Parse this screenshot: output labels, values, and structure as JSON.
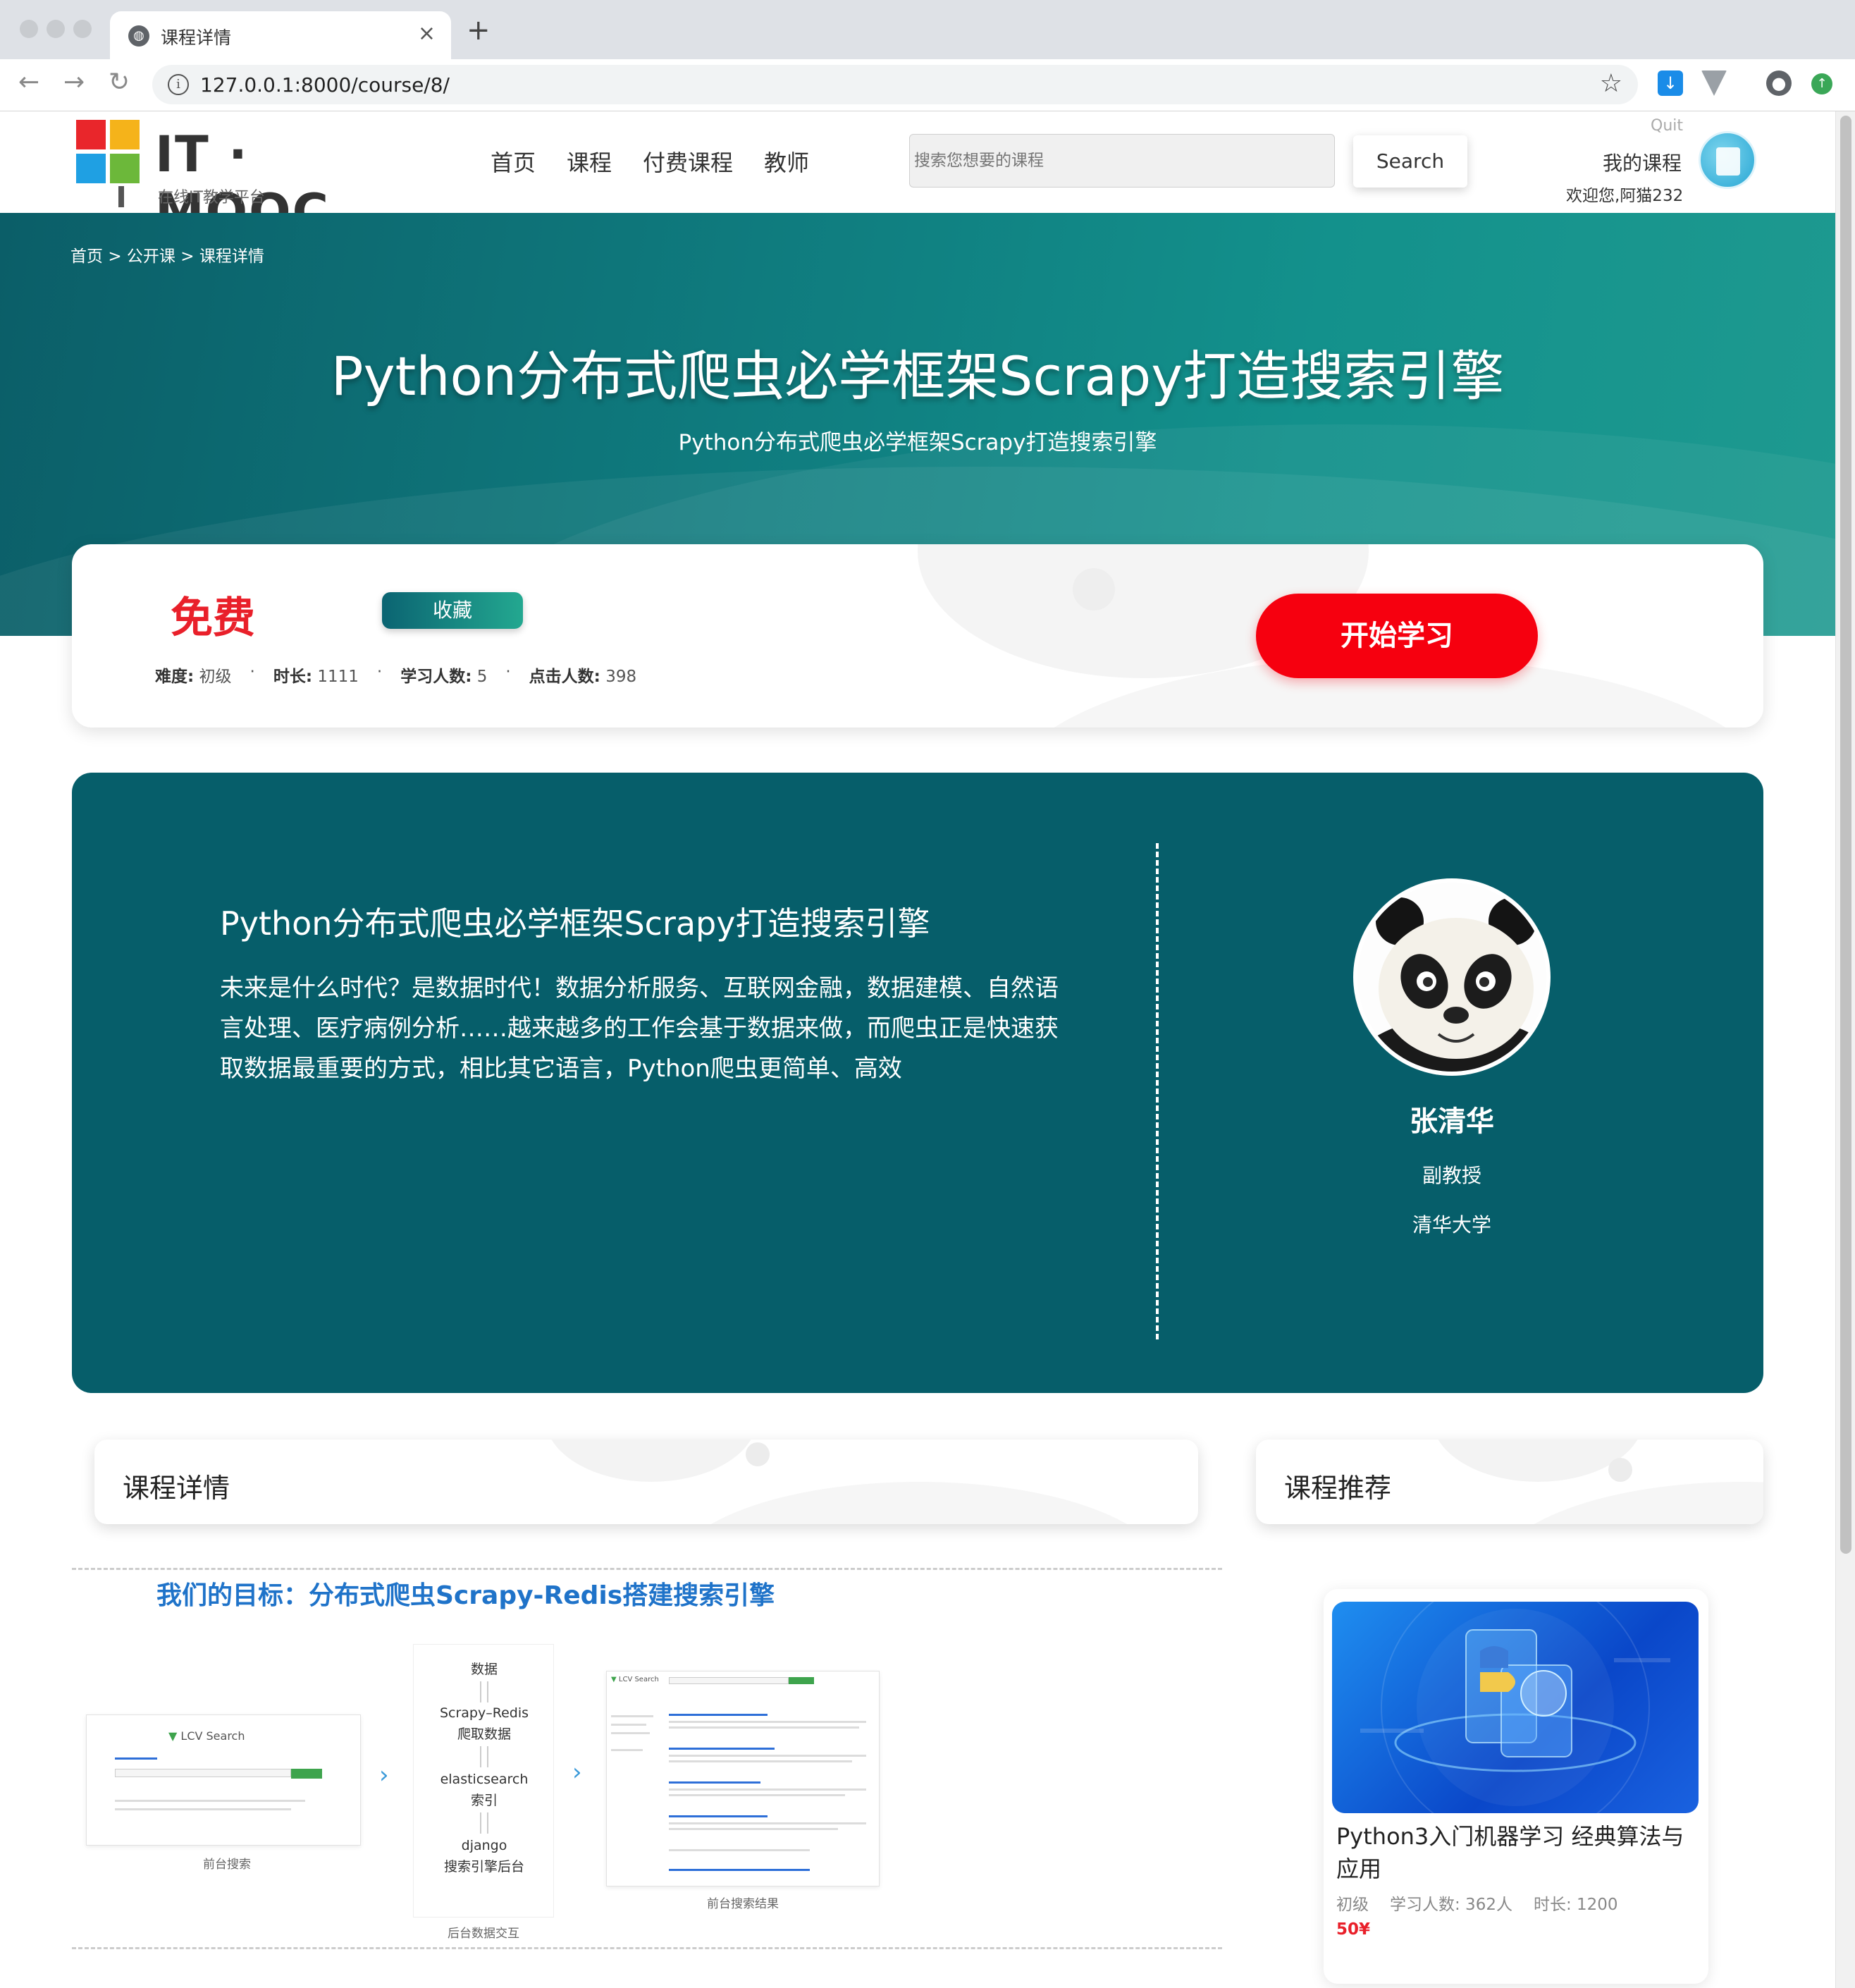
{
  "browser": {
    "tab_title": "课程详情",
    "url": "127.0.0.1:8000/course/8/"
  },
  "header": {
    "logo_text": "IT · MOOC",
    "logo_sub": "在线IT教学平台",
    "nav": [
      "首页",
      "课程",
      "付费课程",
      "教师"
    ],
    "search_placeholder": "搜索您想要的课程",
    "search_button": "Search",
    "quit": "Quit",
    "my_course": "我的课程",
    "welcome": "欢迎您,阿猫232"
  },
  "hero": {
    "breadcrumb": [
      "首页",
      "公开课",
      "课程详情"
    ],
    "breadcrumb_sep": ">",
    "title": "Python分布式爬虫必学框架Scrapy打造搜索引擎",
    "subtitle": "Python分布式爬虫必学框架Scrapy打造搜索引擎"
  },
  "course_info": {
    "price": "免费",
    "favorite": "收藏",
    "start": "开始学习",
    "stats": [
      {
        "label": "难度:",
        "value": "初级"
      },
      {
        "label": "时长:",
        "value": "1111"
      },
      {
        "label": "学习人数:",
        "value": "5"
      },
      {
        "label": "点击人数:",
        "value": "398"
      }
    ]
  },
  "teacher_panel": {
    "course_title": "Python分布式爬虫必学框架Scrapy打造搜索引擎",
    "description": "未来是什么时代？是数据时代！数据分析服务、互联网金融，数据建模、自然语言处理、医疗病例分析……越来越多的工作会基于数据来做，而爬虫正是快速获取数据最重要的方式，相比其它语言，Python爬虫更简单、高效",
    "teacher_name": "张清华",
    "teacher_title": "副教授",
    "teacher_school": "清华大学"
  },
  "sections": {
    "detail": "课程详情",
    "recommend": "课程推荐"
  },
  "detail_content": {
    "goal": "我们的目标：分布式爬虫Scrapy-Redis搭建搜索引擎",
    "front_caption": "前台搜索",
    "flow": {
      "data": "数据",
      "scrapy1": "Scrapy–Redis",
      "scrapy2": "爬取数据",
      "es1": "elasticsearch",
      "es2": "索引",
      "django1": "django",
      "django2": "搜索引擎后台"
    },
    "backend_caption": "后台数据交互",
    "results_caption": "前台搜索结果",
    "lcv_logo": "LCV Search"
  },
  "recommendation": {
    "title": "Python3入门机器学习 经典算法与应用",
    "level": "初级",
    "students": "学习人数: 362人",
    "duration": "时长: 1200",
    "price": "50¥"
  },
  "colors": {
    "hero_teal": "#0f7b7e",
    "panel_teal": "#065e6a",
    "price_red": "#e9202a",
    "start_red": "#f6000f",
    "goal_blue": "#1f73c9"
  }
}
